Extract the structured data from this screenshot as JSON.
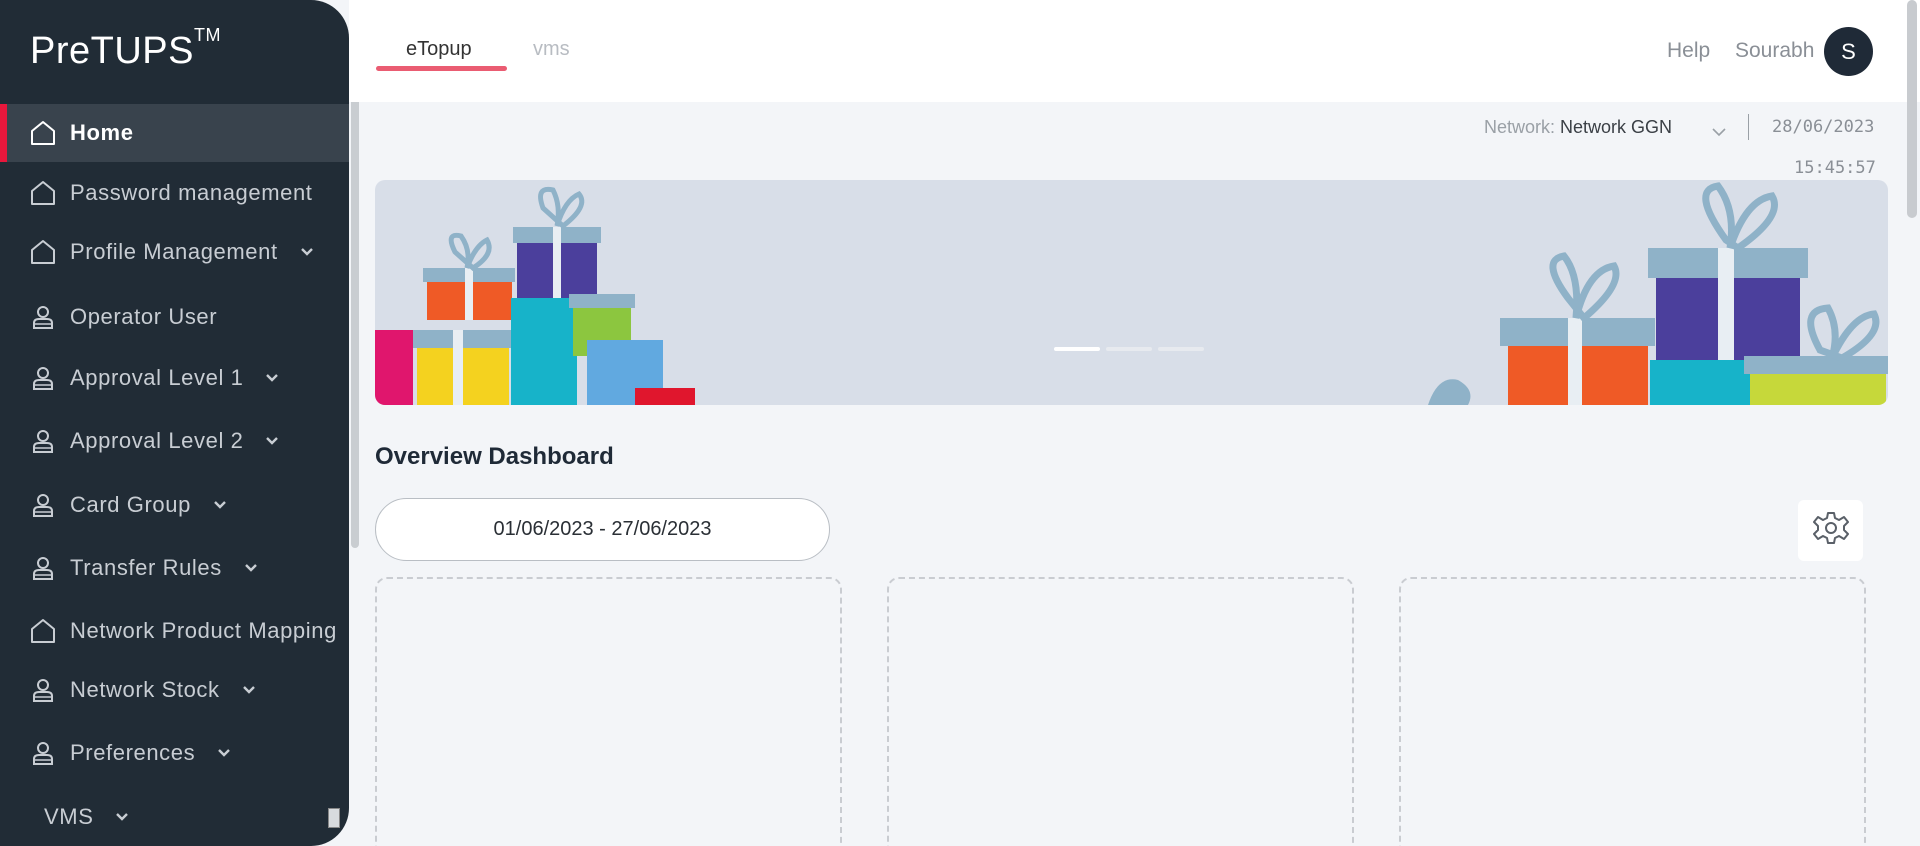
{
  "brand": {
    "name": "PreTUPS",
    "mark": "TM"
  },
  "sidebar": {
    "items": [
      {
        "label": "Home",
        "icon": "home-icon",
        "active": true,
        "expandable": false
      },
      {
        "label": "Password management",
        "icon": "home-icon",
        "active": false,
        "expandable": false
      },
      {
        "label": "Profile Management",
        "icon": "home-icon",
        "active": false,
        "expandable": true
      },
      {
        "label": "Operator User",
        "icon": "user-icon",
        "active": false,
        "expandable": false
      },
      {
        "label": "Approval Level 1",
        "icon": "user-icon",
        "active": false,
        "expandable": true
      },
      {
        "label": "Approval Level 2",
        "icon": "user-icon",
        "active": false,
        "expandable": true
      },
      {
        "label": "Card Group",
        "icon": "user-icon",
        "active": false,
        "expandable": true
      },
      {
        "label": "Transfer Rules",
        "icon": "user-icon",
        "active": false,
        "expandable": true
      },
      {
        "label": "Network Product Mapping",
        "icon": "home-icon",
        "active": false,
        "expandable": false
      },
      {
        "label": "Network Stock",
        "icon": "user-icon",
        "active": false,
        "expandable": true
      },
      {
        "label": "Preferences",
        "icon": "user-icon",
        "active": false,
        "expandable": true
      },
      {
        "label": "VMS",
        "icon": "",
        "active": false,
        "expandable": true
      }
    ]
  },
  "header": {
    "tabs": [
      {
        "label": "eTopup",
        "active": true
      },
      {
        "label": "vms",
        "active": false
      }
    ],
    "help": "Help",
    "user_name": "Sourabh",
    "avatar_initial": "S"
  },
  "meta": {
    "network_label": "Network:",
    "network_value": "Network GGN",
    "date": "28/06/2023",
    "time": "15:45:57"
  },
  "banner": {
    "slide_count": 3,
    "active_slide": 1
  },
  "dashboard": {
    "title": "Overview Dashboard",
    "date_range": "01/06/2023 - 27/06/2023",
    "settings_icon": "gear-icon",
    "card_count": 3
  },
  "colors": {
    "sidebar_bg": "#212c36",
    "active_bar": "#e8173c",
    "tab_underline": "#ea5c72",
    "avatar_bg": "#1f2a37"
  }
}
